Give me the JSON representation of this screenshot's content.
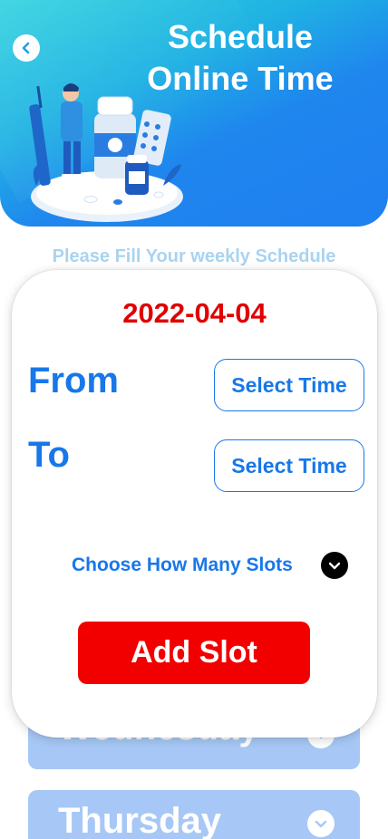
{
  "header": {
    "title_line1": "Schedule",
    "title_line2": "Online Time",
    "back_icon": "chevron-left-icon"
  },
  "subtitle": "Please Fill Your weekly Schedule",
  "days": [
    {
      "label": "Wednesday",
      "icon": "chevron-down-icon"
    },
    {
      "label": "Thursday",
      "icon": "chevron-down-icon"
    }
  ],
  "modal": {
    "date": "2022-04-04",
    "from_label": "From",
    "to_label": "To",
    "from_button": "Select Time",
    "to_button": "Select Time",
    "slots_label": "Choose How Many Slots",
    "slots_icon": "chevron-down-icon",
    "add_button": "Add Slot"
  },
  "colors": {
    "accent_blue": "#1877e9",
    "date_red": "#e00000",
    "add_button_red": "#f20000",
    "day_row_blue": "#a7c8f6"
  }
}
